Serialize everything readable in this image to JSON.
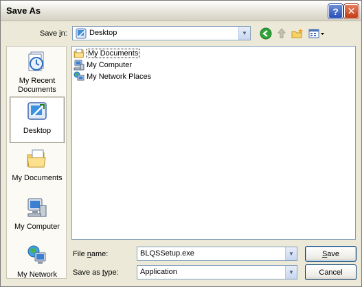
{
  "window": {
    "title": "Save As"
  },
  "titlebar_buttons": {
    "help": "?",
    "close": "✕"
  },
  "save_in": {
    "label_prefix": "Save ",
    "label_hotkey": "i",
    "label_suffix": "n:",
    "value": "Desktop"
  },
  "toolbar": {
    "back_icon": "back-arrow-icon",
    "up_icon": "up-folder-icon",
    "new_folder_icon": "new-folder-icon",
    "views_icon": "views-menu-icon"
  },
  "places": [
    {
      "label": "My Recent Documents",
      "icon": "recent-documents-icon"
    },
    {
      "label": "Desktop",
      "icon": "desktop-icon"
    },
    {
      "label": "My Documents",
      "icon": "my-documents-icon"
    },
    {
      "label": "My Computer",
      "icon": "my-computer-icon"
    },
    {
      "label": "My Network",
      "icon": "my-network-icon"
    }
  ],
  "files": [
    {
      "name": "My Documents",
      "icon": "my-documents-icon"
    },
    {
      "name": "My Computer",
      "icon": "my-computer-icon"
    },
    {
      "name": "My Network Places",
      "icon": "my-network-places-icon"
    }
  ],
  "file_name": {
    "label_prefix": "File ",
    "label_hotkey": "n",
    "label_suffix": "ame:",
    "value": "BLQSSetup.exe"
  },
  "save_type": {
    "label_prefix": "Save as ",
    "label_hotkey": "t",
    "label_suffix": "ype:",
    "value": "Application"
  },
  "buttons": {
    "save_hotkey": "S",
    "save_rest": "ave",
    "cancel": "Cancel"
  },
  "colors": {
    "accent_border": "#7f9db9",
    "window_bg": "#ece9d8",
    "close_red": "#c23b14",
    "help_blue": "#2a4fb6"
  }
}
